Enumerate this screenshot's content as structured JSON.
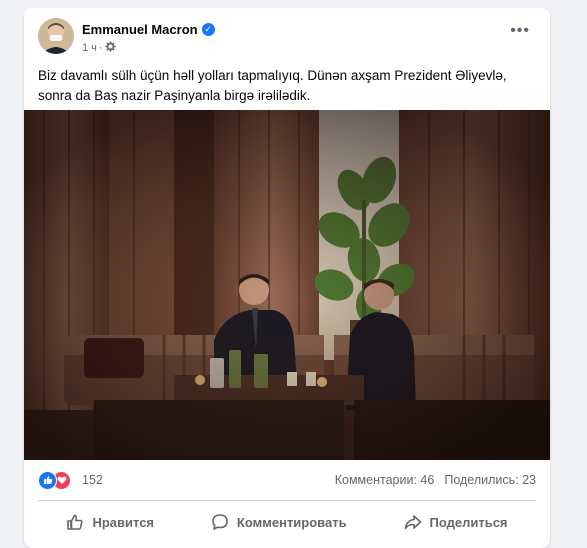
{
  "post": {
    "author": "Emmanuel Macron",
    "time": "1 ч",
    "separator": "·",
    "text": "Biz davamlı sülh üçün həll yolları tapmalıyıq. Dünən axşam Prezident Əliyevlə, sonra da Baş nazir Paşinyanla birgə irəlilədik."
  },
  "reactions": {
    "count": "152",
    "icons": [
      "like-icon",
      "love-icon"
    ]
  },
  "stats": {
    "comments": "Комментарии: 46",
    "shares": "Поделились: 23"
  },
  "actions": {
    "like": "Нравится",
    "comment": "Комментировать",
    "share": "Поделиться"
  },
  "colors": {
    "accent": "#1877f2",
    "love": "#f33e58",
    "text_secondary": "#65676b"
  }
}
